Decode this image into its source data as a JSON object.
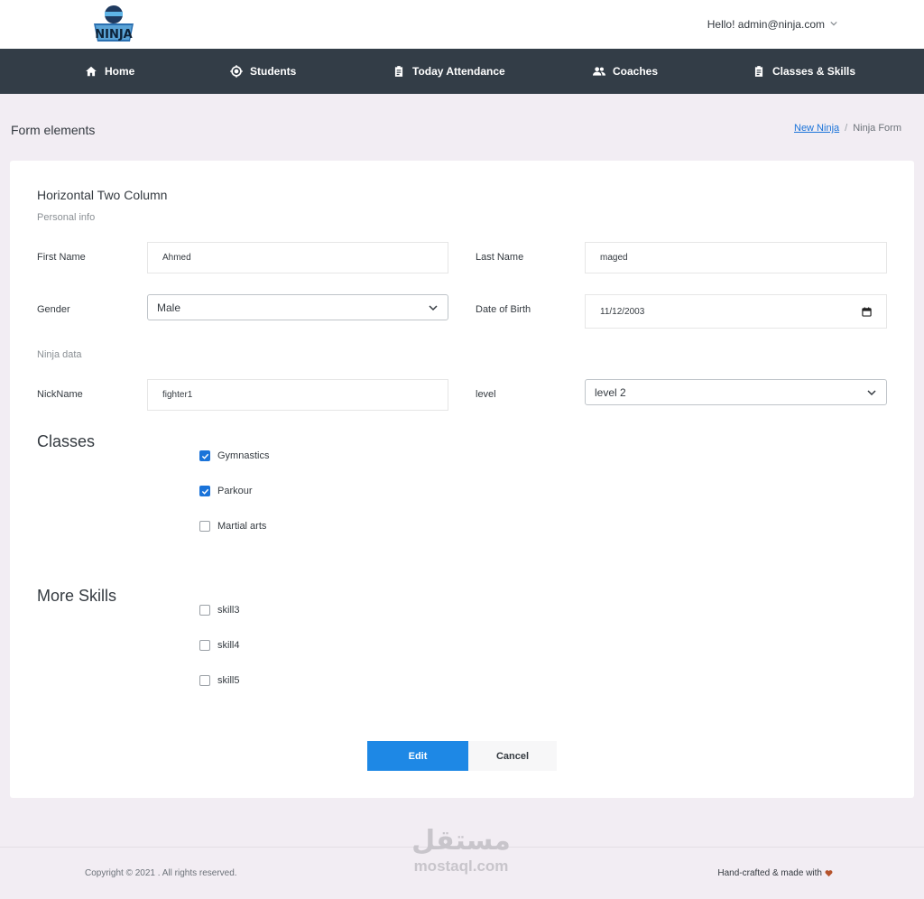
{
  "header": {
    "user_greeting": "Hello! admin@ninja.com",
    "logo_text": "NINJA"
  },
  "nav": {
    "items": [
      {
        "label": "Home",
        "icon": "home-icon"
      },
      {
        "label": "Students",
        "icon": "target-icon"
      },
      {
        "label": "Today Attendance",
        "icon": "clipboard-icon"
      },
      {
        "label": "Coaches",
        "icon": "people-icon"
      },
      {
        "label": "Classes & Skills",
        "icon": "clipboard-icon"
      }
    ]
  },
  "page": {
    "title": "Form elements",
    "breadcrumb": {
      "link": "New Ninja",
      "separator": "/",
      "current": "Ninja Form"
    }
  },
  "form": {
    "title": "Horizontal Two Column",
    "personal_section": "Personal info",
    "first_name": {
      "label": "First Name",
      "value": "Ahmed"
    },
    "last_name": {
      "label": "Last Name",
      "value": "maged"
    },
    "gender": {
      "label": "Gender",
      "value": "Male"
    },
    "dob": {
      "label": "Date of Birth",
      "value": "11/12/2003"
    },
    "ninja_section": "Ninja data",
    "nickname": {
      "label": "NickName",
      "value": "fighter1"
    },
    "level": {
      "label": "level",
      "value": "level 2"
    },
    "classes": {
      "heading": "Classes",
      "items": [
        {
          "label": "Gymnastics",
          "checked": true
        },
        {
          "label": "Parkour",
          "checked": true
        },
        {
          "label": "Martial arts",
          "checked": false
        }
      ]
    },
    "skills": {
      "heading": "More Skills",
      "items": [
        {
          "label": "skill3",
          "checked": false
        },
        {
          "label": "skill4",
          "checked": false
        },
        {
          "label": "skill5",
          "checked": false
        }
      ]
    },
    "edit_label": "Edit",
    "cancel_label": "Cancel"
  },
  "footer": {
    "copyright": "Copyright © 2021 . All rights reserved.",
    "credit": "Hand-crafted & made with"
  },
  "watermark": {
    "arabic": "مستقل",
    "latin": "mostaql.com"
  },
  "colors": {
    "navbar": "#333d47",
    "primary": "#1e88e5",
    "background": "#f2edf3",
    "heart": "#b5532c"
  }
}
